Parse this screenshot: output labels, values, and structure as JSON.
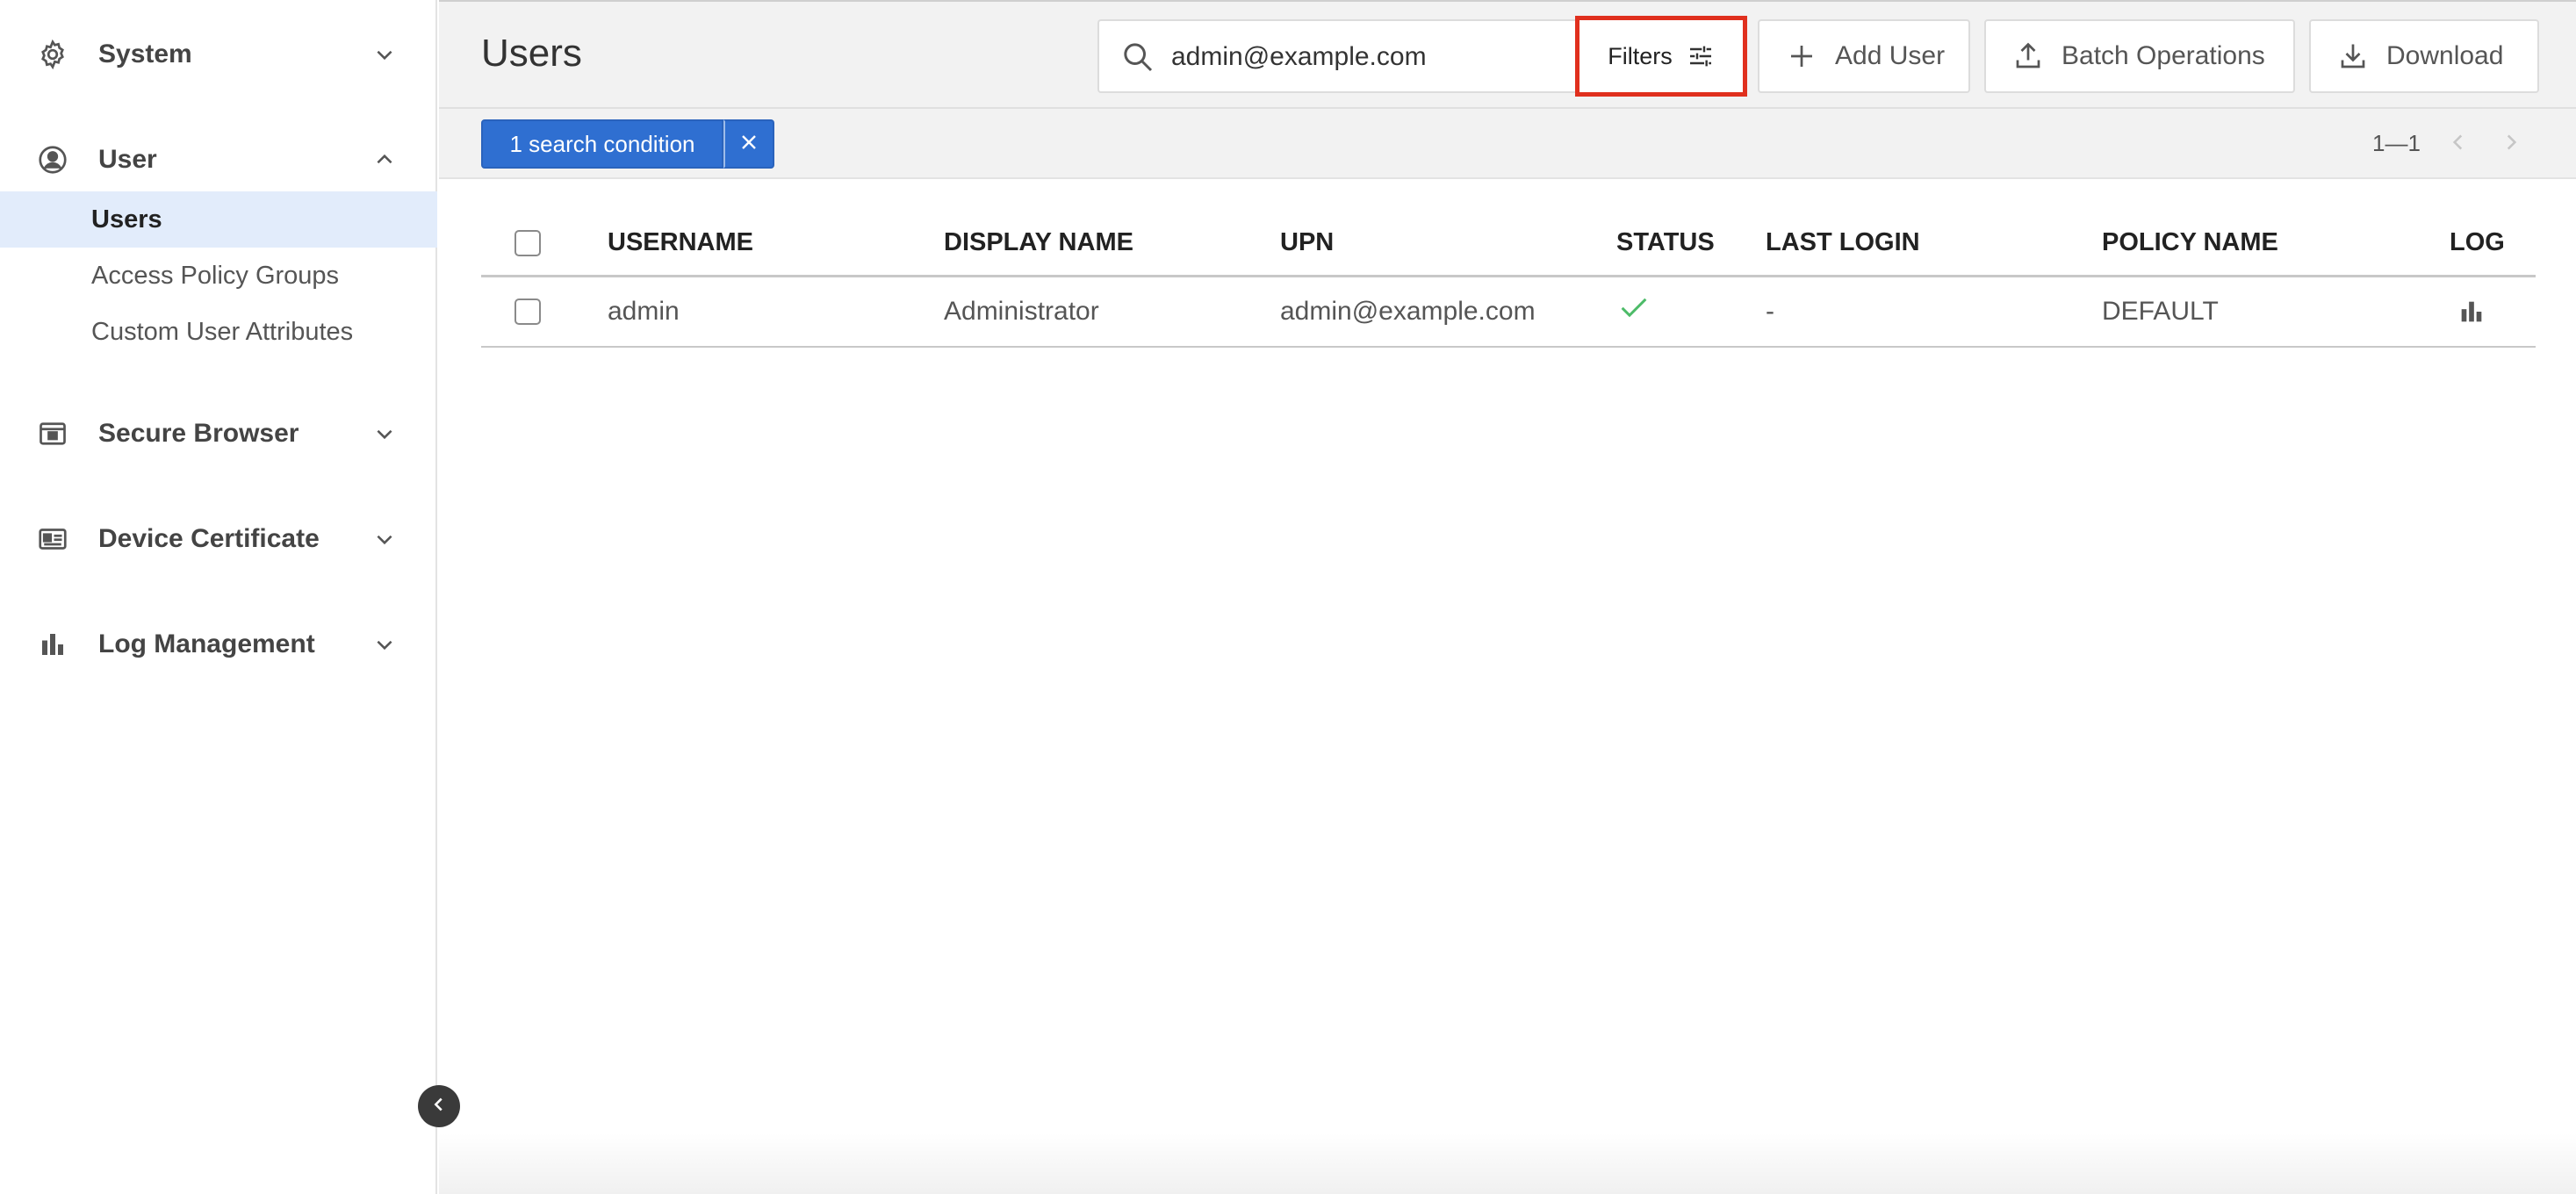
{
  "sidebar": {
    "groups": [
      {
        "label": "System",
        "icon": "gear-icon",
        "expanded": false
      },
      {
        "label": "User",
        "icon": "user-circle-icon",
        "expanded": true
      },
      {
        "label": "Secure Browser",
        "icon": "browser-window-icon",
        "expanded": false
      },
      {
        "label": "Device Certificate",
        "icon": "id-card-icon",
        "expanded": false
      },
      {
        "label": "Log Management",
        "icon": "bar-chart-icon",
        "expanded": false
      }
    ],
    "user_items": [
      {
        "label": "Users",
        "active": true
      },
      {
        "label": "Access Policy Groups",
        "active": false
      },
      {
        "label": "Custom User Attributes",
        "active": false
      }
    ]
  },
  "header": {
    "title": "Users",
    "search_value": "admin@example.com",
    "filters_label": "Filters",
    "add_user_label": "Add User",
    "batch_operations_label": "Batch Operations",
    "download_label": "Download"
  },
  "conditions": {
    "chip_label": "1 search condition",
    "pager_range": "1—1"
  },
  "table": {
    "columns": [
      "USERNAME",
      "DISPLAY NAME",
      "UPN",
      "STATUS",
      "LAST LOGIN",
      "POLICY NAME",
      "LOG"
    ],
    "rows": [
      {
        "username": "admin",
        "display_name": "Administrator",
        "upn": "admin@example.com",
        "status": "active",
        "last_login": "-",
        "policy_name": "DEFAULT"
      }
    ]
  },
  "colors": {
    "accent": "#2f6fd1",
    "highlight_border": "#e0301e",
    "status_ok": "#4cbb68",
    "active_nav_bg": "#e2ecfb"
  }
}
